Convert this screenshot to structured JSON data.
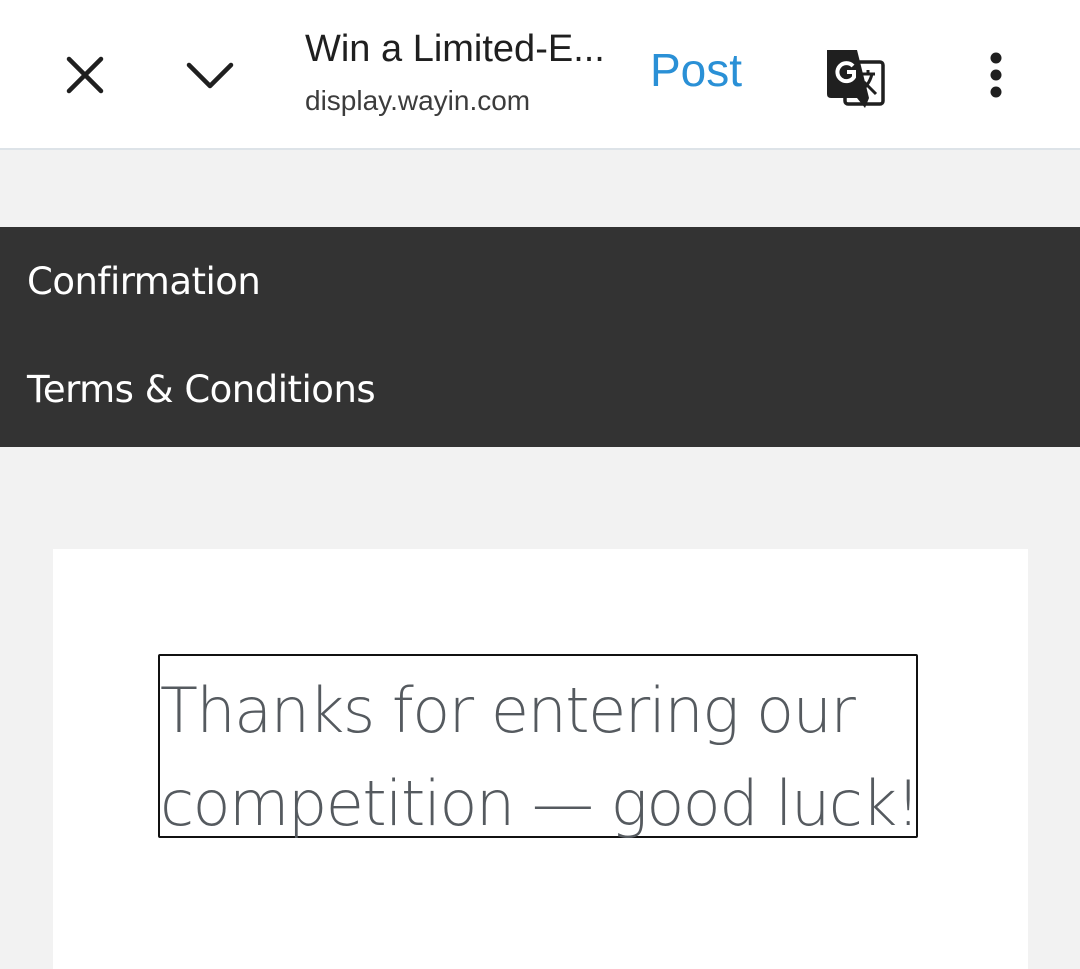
{
  "toolbar": {
    "close_icon": "close-icon",
    "collapse_icon": "chevron-down-icon",
    "page_title": "Win a Limited-E...",
    "page_url": "display.wayin.com",
    "post_label": "Post",
    "translate_icon": "translate-icon",
    "more_icon": "more-vertical-icon"
  },
  "nav": {
    "items": [
      {
        "label": "Confirmation"
      },
      {
        "label": "Terms & Conditions"
      }
    ]
  },
  "card": {
    "message": "Thanks for entering our competition — good luck!"
  },
  "colors": {
    "accent": "#2a90d6",
    "nav_background": "#333333",
    "page_background": "#f2f2f2",
    "message_text": "#555a5f"
  }
}
